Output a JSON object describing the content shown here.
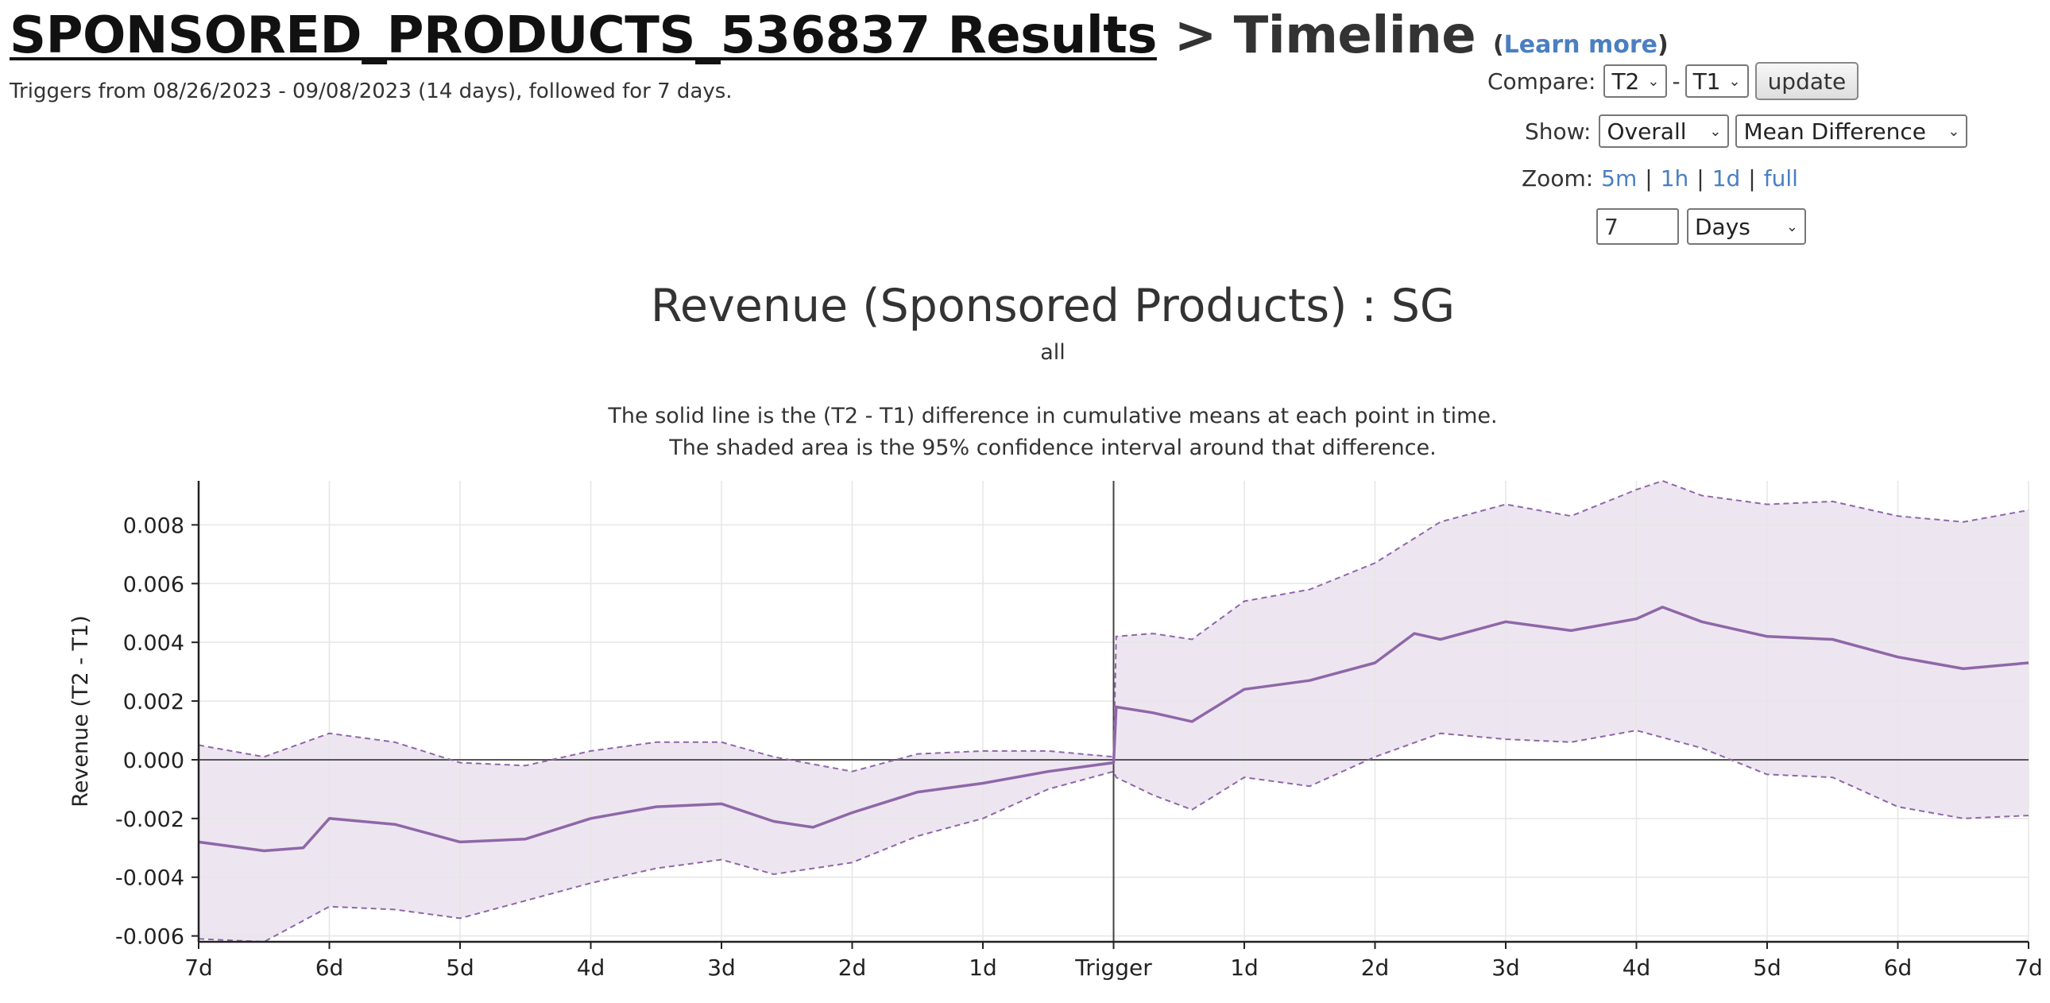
{
  "header": {
    "experiment_link": "SPONSORED_PRODUCTS_536837 Results",
    "title_suffix": " > Timeline ",
    "learn_more_open": "(",
    "learn_more": "Learn more",
    "learn_more_close": ")",
    "subline": "Triggers from 08/26/2023 - 09/08/2023 (14 days), followed for 7 days."
  },
  "controls": {
    "compare_label": "Compare:",
    "compare_a": "T2",
    "compare_sep": "-",
    "compare_b": "T1",
    "update_label": "update",
    "show_label": "Show:",
    "show_segment": "Overall",
    "show_metric": "Mean Difference",
    "zoom_label": "Zoom:",
    "zoom_links": [
      "5m",
      "1h",
      "1d",
      "full"
    ],
    "window_value": "7",
    "window_unit": "Days"
  },
  "chart": {
    "title": "Revenue (Sponsored Products) : SG",
    "subtitle": "all",
    "desc_line1": "The solid line is the (T2 - T1) difference in cumulative means at each point in time.",
    "desc_line2": "The shaded area is the 95% confidence interval around that difference."
  },
  "colors": {
    "line": "#8f67a8",
    "band": "#ede6f1",
    "link": "#4a7fc1",
    "grid": "#e6e6e6"
  },
  "chart_data": {
    "type": "line",
    "ylabel": "Revenue (T2 - T1)",
    "xlabel": "",
    "x_ticks": [
      "7d",
      "6d",
      "5d",
      "4d",
      "3d",
      "2d",
      "1d",
      "Trigger",
      "1d",
      "2d",
      "3d",
      "4d",
      "5d",
      "6d",
      "7d"
    ],
    "xlim": [
      -7,
      7
    ],
    "ylim": [
      -0.0062,
      0.0095
    ],
    "y_ticks": [
      0.008,
      0.006,
      0.004,
      0.002,
      0.0,
      -0.002,
      -0.004,
      -0.006
    ],
    "y_tick_labels": [
      "0.008",
      "0.006",
      "0.004",
      "0.002",
      "0.000",
      "-0.002",
      "-0.004",
      "-0.006"
    ],
    "grid": true,
    "series": [
      {
        "role": "mean_difference",
        "style": "solid",
        "x": [
          -7,
          -6.5,
          -6.2,
          -6,
          -5.5,
          -5,
          -4.5,
          -4,
          -3.5,
          -3,
          -2.6,
          -2.3,
          -2,
          -1.5,
          -1,
          -0.5,
          0,
          0.02,
          0.3,
          0.6,
          1,
          1.5,
          2,
          2.3,
          2.5,
          3,
          3.5,
          4,
          4.2,
          4.5,
          5,
          5.5,
          6,
          6.5,
          7
        ],
        "y": [
          -0.0028,
          -0.0031,
          -0.003,
          -0.002,
          -0.0022,
          -0.0028,
          -0.0027,
          -0.002,
          -0.0016,
          -0.0015,
          -0.0021,
          -0.0023,
          -0.0018,
          -0.0011,
          -0.0008,
          -0.0004,
          -0.0001,
          0.0018,
          0.0016,
          0.0013,
          0.0024,
          0.0027,
          0.0033,
          0.0043,
          0.0041,
          0.0047,
          0.0044,
          0.0048,
          0.0052,
          0.0047,
          0.0042,
          0.0041,
          0.0035,
          0.0031,
          0.0033
        ]
      },
      {
        "role": "ci_upper",
        "style": "dashed",
        "x": [
          -7,
          -6.5,
          -6,
          -5.5,
          -5,
          -4.5,
          -4,
          -3.5,
          -3,
          -2.6,
          -2,
          -1.5,
          -1,
          -0.5,
          0,
          0.02,
          0.3,
          0.6,
          1,
          1.5,
          2,
          2.5,
          3,
          3.5,
          4,
          4.2,
          4.5,
          5,
          5.5,
          6,
          6.5,
          7
        ],
        "y": [
          0.0005,
          0.0001,
          0.0009,
          0.0006,
          -0.0001,
          -0.0002,
          0.0003,
          0.0006,
          0.0006,
          0.0001,
          -0.0004,
          0.0002,
          0.0003,
          0.0003,
          0.0001,
          0.0042,
          0.0043,
          0.0041,
          0.0054,
          0.0058,
          0.0067,
          0.0081,
          0.0087,
          0.0083,
          0.0092,
          0.0095,
          0.009,
          0.0087,
          0.0088,
          0.0083,
          0.0081,
          0.0085
        ]
      },
      {
        "role": "ci_lower",
        "style": "dashed",
        "x": [
          -7,
          -6.5,
          -6,
          -5.5,
          -5,
          -4.5,
          -4,
          -3.5,
          -3,
          -2.6,
          -2,
          -1.5,
          -1,
          -0.5,
          0,
          0.02,
          0.3,
          0.6,
          1,
          1.5,
          2,
          2.5,
          3,
          3.5,
          4,
          4.5,
          5,
          5.5,
          6,
          6.5,
          7
        ],
        "y": [
          -0.0061,
          -0.0062,
          -0.005,
          -0.0051,
          -0.0054,
          -0.0048,
          -0.0042,
          -0.0037,
          -0.0034,
          -0.0039,
          -0.0035,
          -0.0026,
          -0.002,
          -0.001,
          -0.0004,
          -0.0006,
          -0.0012,
          -0.0017,
          -0.0006,
          -0.0009,
          0.0001,
          0.0009,
          0.0007,
          0.0006,
          0.001,
          0.0004,
          -0.0005,
          -0.0006,
          -0.0016,
          -0.002,
          -0.0019
        ]
      }
    ]
  }
}
